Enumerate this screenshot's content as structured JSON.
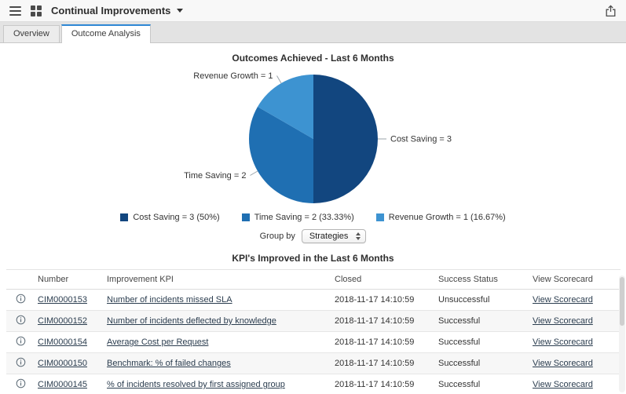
{
  "colors": {
    "accent": "#2e87d4",
    "link": "#2b3d4f"
  },
  "header": {
    "title": "Continual Improvements"
  },
  "tabs": [
    {
      "label": "Overview"
    },
    {
      "label": "Outcome Analysis"
    }
  ],
  "chart_data": {
    "type": "pie",
    "title": "Outcomes Achieved - Last 6 Months",
    "total": 6,
    "legend_position": "bottom",
    "slices": [
      {
        "label": "Cost Saving",
        "value": 3,
        "percent": 50,
        "color": "#12467f",
        "callout": "Cost Saving = 3",
        "legend": "Cost Saving = 3 (50%)"
      },
      {
        "label": "Time Saving",
        "value": 2,
        "percent": 33.33,
        "color": "#1f6fb2",
        "callout": "Time Saving = 2",
        "legend": "Time Saving = 2 (33.33%)"
      },
      {
        "label": "Revenue Growth",
        "value": 1,
        "percent": 16.67,
        "color": "#3d93d1",
        "callout": "Revenue Growth = 1",
        "legend": "Revenue Growth = 1 (16.67%)"
      }
    ]
  },
  "group_by": {
    "label": "Group by",
    "selected": "Strategies"
  },
  "kpi_table": {
    "title": "KPI's Improved in the Last 6 Months",
    "columns": [
      "Number",
      "Improvement KPI",
      "Closed",
      "Success Status",
      "View Scorecard"
    ],
    "rows": [
      {
        "number": "CIM0000153",
        "kpi": "Number of incidents missed SLA",
        "closed": "2018-11-17 14:10:59",
        "status": "Unsuccessful",
        "scorecard": "View Scorecard"
      },
      {
        "number": "CIM0000152",
        "kpi": "Number of incidents deflected by knowledge",
        "closed": "2018-11-17 14:10:59",
        "status": "Successful",
        "scorecard": "View Scorecard"
      },
      {
        "number": "CIM0000154",
        "kpi": "Average Cost per Request",
        "closed": "2018-11-17 14:10:59",
        "status": "Successful",
        "scorecard": "View Scorecard"
      },
      {
        "number": "CIM0000150",
        "kpi": "Benchmark: % of failed changes",
        "closed": "2018-11-17 14:10:59",
        "status": "Successful",
        "scorecard": "View Scorecard"
      },
      {
        "number": "CIM0000145",
        "kpi": "% of incidents resolved by first assigned group",
        "closed": "2018-11-17 14:10:59",
        "status": "Successful",
        "scorecard": "View Scorecard"
      }
    ]
  }
}
